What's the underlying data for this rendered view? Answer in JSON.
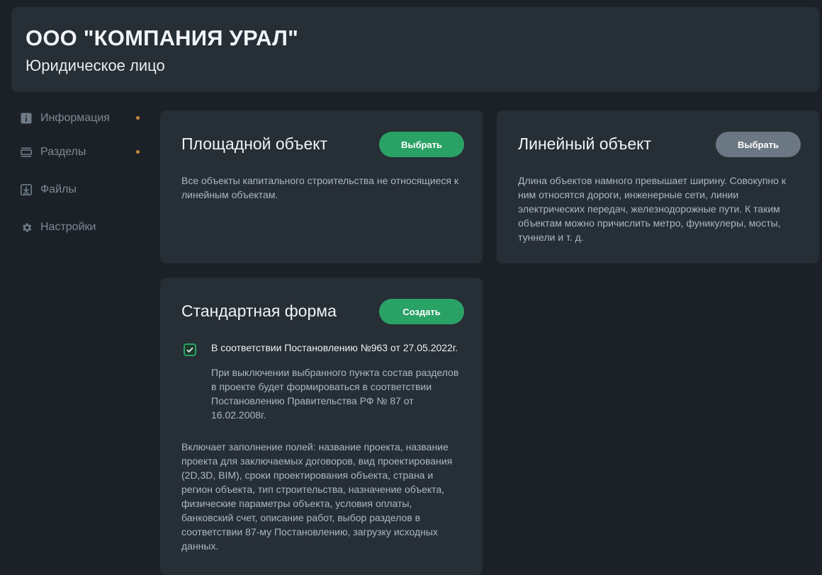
{
  "header": {
    "company_name": "ООО \"КОМПАНИЯ УРАЛ\"",
    "entity_type": "Юридическое лицо"
  },
  "sidebar": {
    "items": [
      {
        "label": "Информация",
        "icon": "info-icon",
        "has_dot": true
      },
      {
        "label": "Разделы",
        "icon": "sections-icon",
        "has_dot": true
      },
      {
        "label": "Файлы",
        "icon": "download-file-icon",
        "has_dot": false
      },
      {
        "label": "Настройки",
        "icon": "gear-icon",
        "has_dot": false
      }
    ]
  },
  "cards": {
    "area_object": {
      "title": "Площадной объект",
      "button_label": "Выбрать",
      "description": "Все объекты капитального строительства не относящиеся к линейным объектам."
    },
    "linear_object": {
      "title": "Линейный объект",
      "button_label": "Выбрать",
      "description": "Длина объектов намного превышает ширину. Совокупно к ним относятся дороги, инженерные сети, линии электрических передач, железнодорожные пути. К таким объектам можно причислить метро, фуникулеры, мосты, туннели и т. д."
    },
    "standard_form": {
      "title": "Стандартная форма",
      "button_label": "Создать",
      "checkbox_label": "В соответствии Постановлению №963 от 27.05.2022г.",
      "checkbox_checked": true,
      "checkbox_hint": "При выключении выбранного пункта состав разделов в проекте будет формироваться в соответствии Постановлению Правительства РФ № 87 от 16.02.2008г.",
      "description": "Включает заполнение полей: название проекта, название проекта для заключаемых договоров, вид проектирования (2D,3D, BIM), сроки проектирования объекта, страна и регион объекта, тип строительства, назначение объекта, физические параметры объекта, условия оплаты, банковский счет, описание работ, выбор разделов в соответствии 87-му Постановлению, загрузку исходных данных."
    }
  },
  "colors": {
    "background": "#1b2127",
    "panel": "#262e36",
    "accent_green": "#2aa265",
    "button_gray": "#6b7782",
    "indicator_dot": "#c98a3c"
  }
}
